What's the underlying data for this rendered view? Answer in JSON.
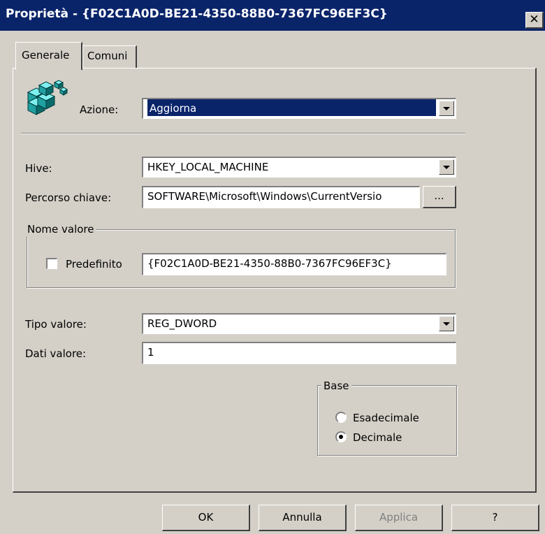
{
  "window": {
    "title": "Proprietà - {F02C1A0D-BE21-4350-88B0-7367FC96EF3C}",
    "close_label": "✕"
  },
  "tabs": [
    {
      "label": "Generale",
      "active": true
    },
    {
      "label": "Comuni",
      "active": false
    }
  ],
  "icons": {
    "action_icon": "registry-blocks-icon"
  },
  "form": {
    "azione": {
      "label": "Azione:",
      "value": "Aggiorna"
    },
    "hive": {
      "label": "Hive:",
      "value": "HKEY_LOCAL_MACHINE"
    },
    "percorso": {
      "label": "Percorso chiave:",
      "value": "SOFTWARE\\Microsoft\\Windows\\CurrentVersio",
      "browse_label": "..."
    },
    "nome_valore": {
      "group_label": "Nome valore",
      "predefinito_label": "Predefinito",
      "predefinito_checked": false,
      "value": "{F02C1A0D-BE21-4350-88B0-7367FC96EF3C}"
    },
    "tipo_valore": {
      "label": "Tipo valore:",
      "value": "REG_DWORD"
    },
    "dati_valore": {
      "label": "Dati valore:",
      "value": "1"
    },
    "base": {
      "group_label": "Base",
      "options": [
        {
          "label": "Esadecimale",
          "checked": false
        },
        {
          "label": "Decimale",
          "checked": true
        }
      ]
    }
  },
  "buttons": {
    "ok": "OK",
    "annulla": "Annulla",
    "applica": "Applica",
    "help": "?"
  },
  "colors": {
    "titlebar": "#0a246a",
    "face": "#d4d0c8",
    "selection": "#0a246a"
  }
}
